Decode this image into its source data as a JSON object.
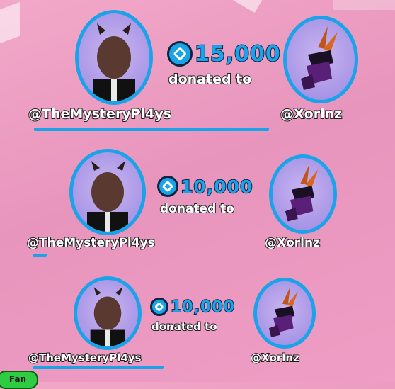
{
  "donations": [
    {
      "amount": "15,000",
      "donated_text": "donated to",
      "donor": "@TheMysteryPl4ys",
      "recipient": "@Xorlnz",
      "progress": 1.0
    },
    {
      "amount": "10,000",
      "donated_text": "donated to",
      "donor": "@TheMysteryPl4ys",
      "recipient": "@Xorlnz",
      "progress": 0.1
    },
    {
      "amount": "10,000",
      "donated_text": "donated to",
      "donor": "@TheMysteryPl4ys",
      "recipient": "@Xorlnz",
      "progress": 0.85
    }
  ],
  "footer_tag": "Fan",
  "colors": {
    "accent": "#1aa3e8",
    "background": "#ef9dc4",
    "tag": "#2ecc40"
  },
  "icons": {
    "currency": "robux-icon"
  }
}
